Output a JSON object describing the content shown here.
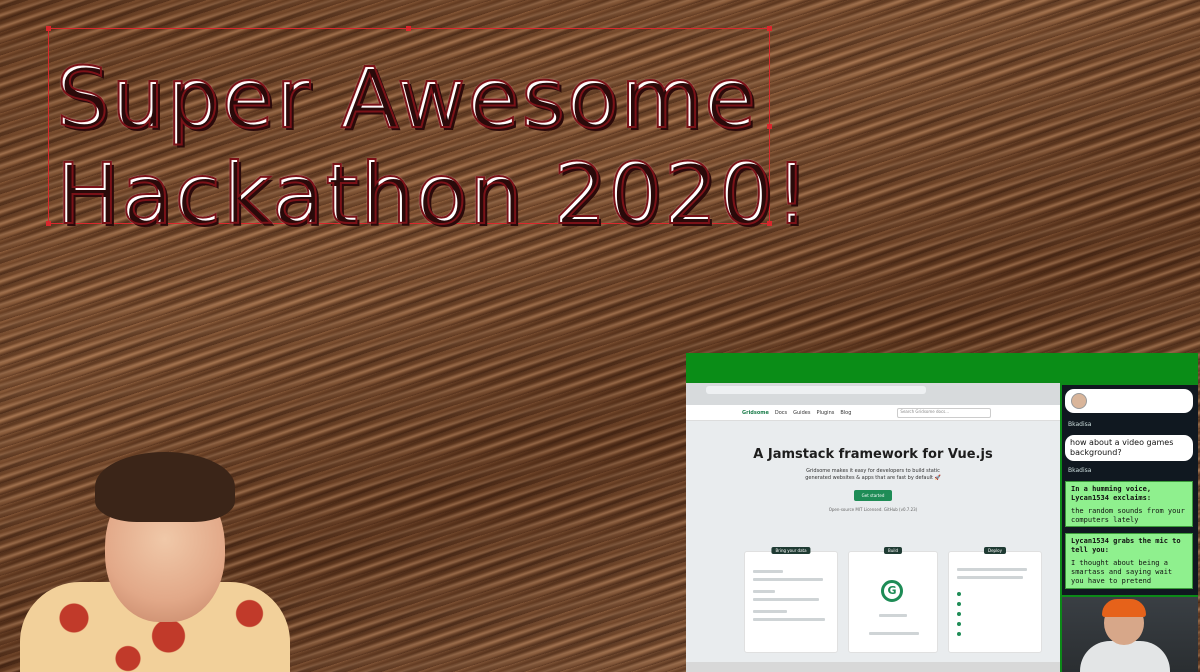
{
  "overlay": {
    "title_line1": "Super Awesome",
    "title_line2": "Hackathon 2020!"
  },
  "browser": {
    "nav": {
      "logo": "Gridsome",
      "links": [
        "Docs",
        "Guides",
        "Plugins",
        "Blog"
      ],
      "search_placeholder": "Search Gridsome docs..."
    },
    "hero": {
      "heading": "A Jamstack framework for Vue.js",
      "description": "Gridsome makes it easy for developers to build static generated websites & apps that are fast by default 🚀",
      "cta": "Get started",
      "subtext": "Open-source MIT Licensed. GitHub (v0.7.23)"
    },
    "cards": [
      {
        "tag": "Bring your data"
      },
      {
        "tag": "Build",
        "badge": "G"
      },
      {
        "tag": "Deploy"
      }
    ]
  },
  "chat": {
    "messages": [
      {
        "author": "Bkadisa",
        "text": ""
      },
      {
        "author": "Bkadisa",
        "text": "how about a video games background?"
      }
    ],
    "alerts": [
      {
        "headline": "In a humming voice, Lycan1534 exclaims:",
        "message": "the random sounds from your computers lately"
      },
      {
        "headline": "Lycan1534 grabs the mic to tell you:",
        "message": "I thought about being a smartass and saying wait you have to pretend"
      }
    ]
  },
  "colors": {
    "title_red": "#d8282d",
    "stream_green": "#0a8d17",
    "alert_green": "#8ff08e",
    "gridsome_green": "#1e8c56"
  }
}
